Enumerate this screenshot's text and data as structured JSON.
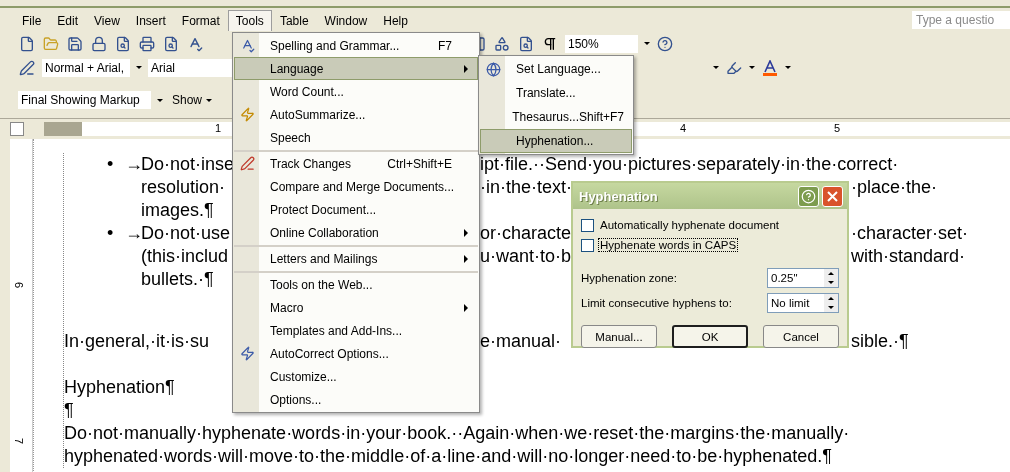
{
  "menu_bar": [
    {
      "label": "File",
      "selected": false
    },
    {
      "label": "Edit",
      "selected": false
    },
    {
      "label": "View",
      "selected": false
    },
    {
      "label": "Insert",
      "selected": false
    },
    {
      "label": "Format",
      "selected": false
    },
    {
      "label": "Tools",
      "selected": true
    },
    {
      "label": "Table",
      "selected": false
    },
    {
      "label": "Window",
      "selected": false
    },
    {
      "label": "Help",
      "selected": false
    }
  ],
  "help_search": {
    "placeholder": "Type a questio"
  },
  "standard_toolbar": {
    "zoom": "150%"
  },
  "formatting_toolbar": {
    "style": "Normal + Arial,",
    "font": "Arial"
  },
  "reviewing_toolbar": {
    "display": "Final Showing Markup",
    "show": "Show"
  },
  "ruler": {
    "numbers": [
      "1",
      "4",
      "5"
    ]
  },
  "vertical_ruler": {
    "numbers": [
      "6",
      "7"
    ]
  },
  "document": {
    "lines": [
      {
        "kind": "bullet",
        "marker": "•",
        "arrow": "→",
        "left": "Do·not·inse",
        "middle": "ipt·file.··Send·you·pictures·separately·in·the·correct·"
      },
      {
        "kind": "continuation",
        "left": "resolution·",
        "middle": "·in·the·text·",
        "right": "·place·the·"
      },
      {
        "kind": "continuation",
        "left": "images.¶"
      },
      {
        "kind": "bullet",
        "marker": "•",
        "arrow": "→",
        "left": "Do·not·use",
        "middle": "or·characte",
        "right": "·character·set·"
      },
      {
        "kind": "continuation",
        "left": "(this·includ",
        "middle": "u·want·to·b",
        "right": "with·standard·"
      },
      {
        "kind": "continuation",
        "left": "bullets.·¶"
      },
      {
        "kind": "body",
        "left": "In·general,·it·is·su",
        "middle": "e·manual·",
        "right": "sible.·¶"
      },
      {
        "kind": "heading",
        "left": "Hyphenation¶"
      },
      {
        "kind": "body",
        "left": "¶"
      },
      {
        "kind": "body",
        "left": "Do·not·manually·hyphenate·words·in·your·book.··Again·when·we·reset·the·margins·the·manually·"
      },
      {
        "kind": "body",
        "left": "hyphenated·words·will·move·to·the·middle·of·a·line·and·will·no·longer·need·to·be·hyphenated.¶"
      }
    ]
  },
  "tools_menu": {
    "items": [
      {
        "label": "Spelling and Grammar...",
        "shortcut": "F7",
        "submenu": false,
        "selected": false
      },
      {
        "label": "Language",
        "submenu": true,
        "selected": true
      },
      {
        "label": "Word Count...",
        "submenu": false,
        "selected": false
      },
      {
        "label": "AutoSummarize...",
        "submenu": false,
        "selected": false
      },
      {
        "label": "Speech",
        "submenu": false,
        "selected": false
      },
      {
        "label": "Track Changes",
        "shortcut": "Ctrl+Shift+E",
        "submenu": false,
        "selected": false,
        "separator_before": true
      },
      {
        "label": "Compare and Merge Documents...",
        "submenu": false,
        "selected": false
      },
      {
        "label": "Protect Document...",
        "submenu": false,
        "selected": false
      },
      {
        "label": "Online Collaboration",
        "submenu": true,
        "selected": false
      },
      {
        "label": "Letters and Mailings",
        "submenu": true,
        "selected": false,
        "separator_before": true
      },
      {
        "label": "Tools on the Web...",
        "submenu": false,
        "selected": false,
        "separator_before": true
      },
      {
        "label": "Macro",
        "submenu": true,
        "selected": false
      },
      {
        "label": "Templates and Add-Ins...",
        "submenu": false,
        "selected": false
      },
      {
        "label": "AutoCorrect Options...",
        "submenu": false,
        "selected": false
      },
      {
        "label": "Customize...",
        "submenu": false,
        "selected": false
      },
      {
        "label": "Options...",
        "submenu": false,
        "selected": false
      }
    ]
  },
  "language_submenu": {
    "items": [
      {
        "label": "Set Language...",
        "selected": false
      },
      {
        "label": "Translate...",
        "selected": false
      },
      {
        "label": "Thesaurus...",
        "shortcut": "Shift+F7",
        "selected": false
      },
      {
        "label": "Hyphenation...",
        "selected": true
      }
    ]
  },
  "dialog": {
    "title": "Hyphenation",
    "checkboxes": [
      {
        "label": "Automatically hyphenate document",
        "checked": false,
        "focused": false
      },
      {
        "label": "Hyphenate words in CAPS",
        "checked": false,
        "focused": true
      }
    ],
    "fields": [
      {
        "label": "Hyphenation zone:",
        "value": "0.25\""
      },
      {
        "label": "Limit consecutive hyphens to:",
        "value": "No limit"
      }
    ],
    "buttons": [
      {
        "label": "Manual...",
        "default": false
      },
      {
        "label": "OK",
        "default": true
      },
      {
        "label": "Cancel",
        "default": false
      }
    ]
  }
}
